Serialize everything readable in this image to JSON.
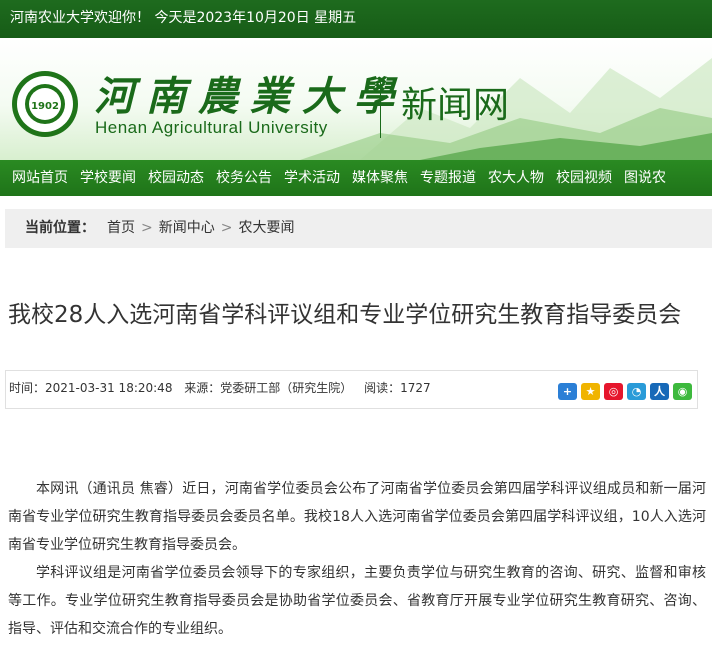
{
  "topbar": {
    "welcome": "河南农业大学欢迎你！ 今天是2023年10月20日 星期五"
  },
  "header": {
    "logo_cn": "河南農業大學",
    "logo_en": "Henan Agricultural University",
    "site_name": "新闻网",
    "seal_year": "1902"
  },
  "nav": {
    "items": [
      "网站首页",
      "学校要闻",
      "校园动态",
      "校务公告",
      "学术活动",
      "媒体聚焦",
      "专题报道",
      "农大人物",
      "校园视频",
      "图说农"
    ]
  },
  "breadcrumb": {
    "label": "当前位置：",
    "items": [
      "首页",
      "新闻中心",
      "农大要闻"
    ]
  },
  "article": {
    "title": "我校28人入选河南省学科评议组和专业学位研究生教育指导委员会",
    "time": "时间：2021-03-31 18:20:48",
    "source": "来源：党委研工部（研究生院）",
    "views": "阅读：1727",
    "paragraphs": [
      "本网讯（通讯员 焦睿）近日，河南省学位委员会公布了河南省学位委员会第四届学科评议组成员和新一届河南省专业学位研究生教育指导委员会委员名单。我校18人入选河南省学位委员会第四届学科评议组，10人入选河南省专业学位研究生教育指导委员会。",
      "学科评议组是河南省学位委员会领导下的专家组织，主要负责学位与研究生教育的咨询、研究、监督和审核等工作。专业学位研究生教育指导委员会是协助省学位委员会、省教育厅开展专业学位研究生教育研究、咨询、指导、评估和交流合作的专业组织。"
    ]
  },
  "share_icons": [
    "plus-share-icon",
    "qzone-icon",
    "weibo-icon",
    "tencent-weibo-icon",
    "renren-icon",
    "wechat-icon"
  ],
  "colors": {
    "brand_green": "#1f7419",
    "logo_green": "#1a6a1a"
  }
}
